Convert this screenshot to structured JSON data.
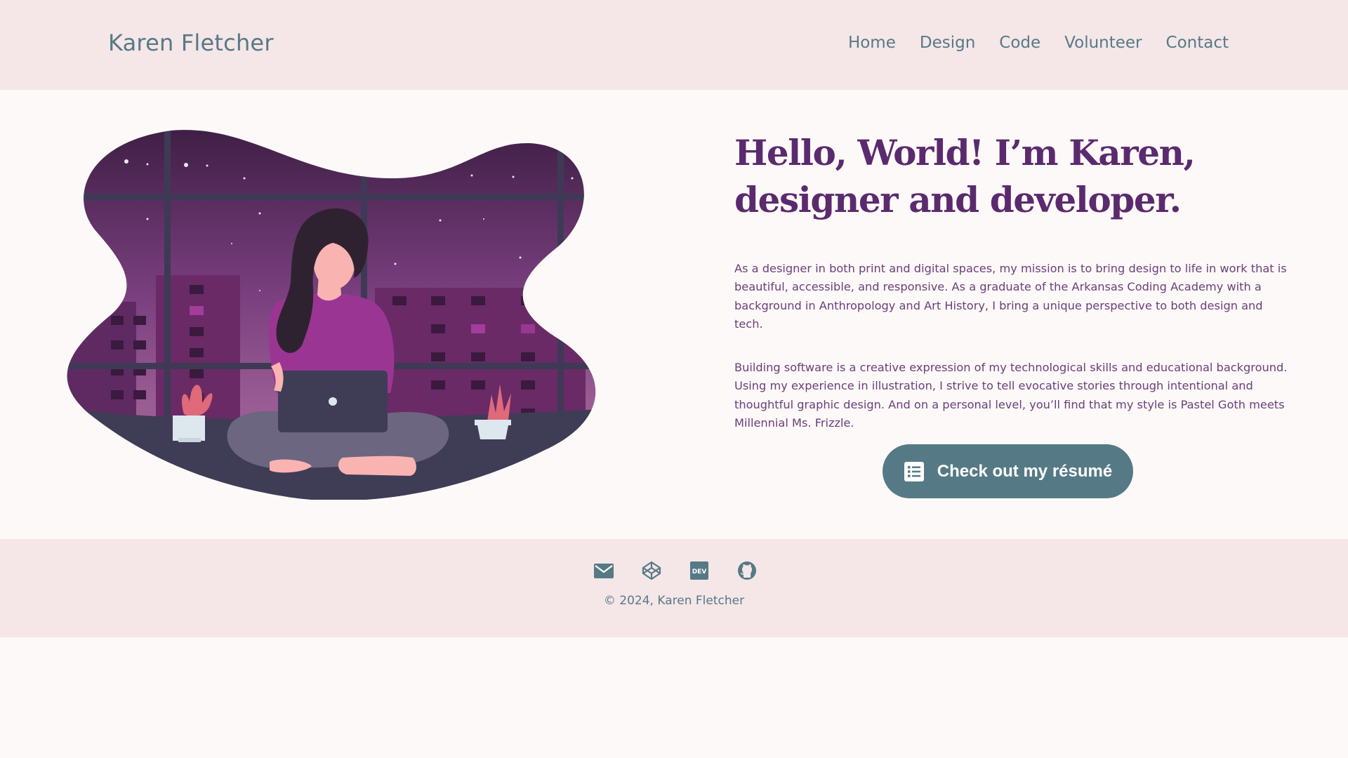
{
  "header": {
    "brand": "Karen Fletcher",
    "nav": [
      {
        "label": "Home"
      },
      {
        "label": "Design"
      },
      {
        "label": "Code"
      },
      {
        "label": "Volunteer"
      },
      {
        "label": "Contact"
      }
    ]
  },
  "hero": {
    "headline": "Hello, World! I’m Karen, designer and developer.",
    "paragraph_1": "As a designer in both print and digital spaces, my mission is to bring design to life in work that is beautiful, accessible, and responsive. As a graduate of the Arkansas Coding Academy with a background in Anthropology and Art History, I bring a unique perspective to both design and tech.",
    "paragraph_2": "Building software is a creative expression of my technological skills and educational background. Using my experience in illustration, I strive to tell evocative stories through intentional and thoughtful graphic design. And on a personal level, you’ll find that my style is Pastel Goth meets Millennial Ms. Frizzle.",
    "cta_label": "Check out my résumé",
    "cta_icon": "document-list-icon"
  },
  "footer": {
    "social_icons": [
      "email-icon",
      "codepen-icon",
      "dev-icon",
      "github-icon"
    ],
    "dev_badge_text": "DEV",
    "copyright": "© 2024, Karen Fletcher"
  },
  "colors": {
    "header_bg": "#f5e6e7",
    "page_bg": "#fdf9f8",
    "accent_teal": "#557a86",
    "headline_purple": "#5b2a6e",
    "body_purple": "#6a3f7a"
  }
}
